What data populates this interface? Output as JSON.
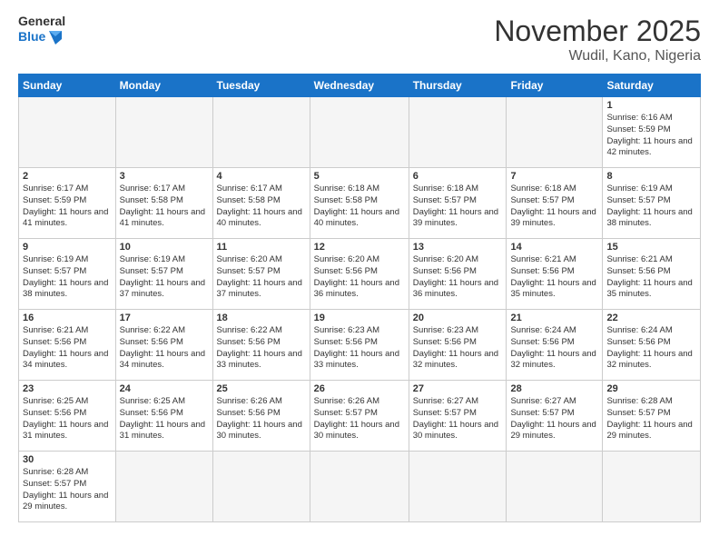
{
  "header": {
    "logo_general": "General",
    "logo_blue": "Blue",
    "month_title": "November 2025",
    "location": "Wudil, Kano, Nigeria"
  },
  "weekdays": [
    "Sunday",
    "Monday",
    "Tuesday",
    "Wednesday",
    "Thursday",
    "Friday",
    "Saturday"
  ],
  "weeks": [
    [
      {
        "day": "",
        "empty": true
      },
      {
        "day": "",
        "empty": true
      },
      {
        "day": "",
        "empty": true
      },
      {
        "day": "",
        "empty": true
      },
      {
        "day": "",
        "empty": true
      },
      {
        "day": "",
        "empty": true
      },
      {
        "day": "1",
        "sunrise": "6:16 AM",
        "sunset": "5:59 PM",
        "daylight": "11 hours and 42 minutes."
      }
    ],
    [
      {
        "day": "2",
        "sunrise": "6:17 AM",
        "sunset": "5:59 PM",
        "daylight": "11 hours and 41 minutes."
      },
      {
        "day": "3",
        "sunrise": "6:17 AM",
        "sunset": "5:58 PM",
        "daylight": "11 hours and 41 minutes."
      },
      {
        "day": "4",
        "sunrise": "6:17 AM",
        "sunset": "5:58 PM",
        "daylight": "11 hours and 40 minutes."
      },
      {
        "day": "5",
        "sunrise": "6:18 AM",
        "sunset": "5:58 PM",
        "daylight": "11 hours and 40 minutes."
      },
      {
        "day": "6",
        "sunrise": "6:18 AM",
        "sunset": "5:57 PM",
        "daylight": "11 hours and 39 minutes."
      },
      {
        "day": "7",
        "sunrise": "6:18 AM",
        "sunset": "5:57 PM",
        "daylight": "11 hours and 39 minutes."
      },
      {
        "day": "8",
        "sunrise": "6:19 AM",
        "sunset": "5:57 PM",
        "daylight": "11 hours and 38 minutes."
      }
    ],
    [
      {
        "day": "9",
        "sunrise": "6:19 AM",
        "sunset": "5:57 PM",
        "daylight": "11 hours and 38 minutes."
      },
      {
        "day": "10",
        "sunrise": "6:19 AM",
        "sunset": "5:57 PM",
        "daylight": "11 hours and 37 minutes."
      },
      {
        "day": "11",
        "sunrise": "6:20 AM",
        "sunset": "5:57 PM",
        "daylight": "11 hours and 37 minutes."
      },
      {
        "day": "12",
        "sunrise": "6:20 AM",
        "sunset": "5:56 PM",
        "daylight": "11 hours and 36 minutes."
      },
      {
        "day": "13",
        "sunrise": "6:20 AM",
        "sunset": "5:56 PM",
        "daylight": "11 hours and 36 minutes."
      },
      {
        "day": "14",
        "sunrise": "6:21 AM",
        "sunset": "5:56 PM",
        "daylight": "11 hours and 35 minutes."
      },
      {
        "day": "15",
        "sunrise": "6:21 AM",
        "sunset": "5:56 PM",
        "daylight": "11 hours and 35 minutes."
      }
    ],
    [
      {
        "day": "16",
        "sunrise": "6:21 AM",
        "sunset": "5:56 PM",
        "daylight": "11 hours and 34 minutes."
      },
      {
        "day": "17",
        "sunrise": "6:22 AM",
        "sunset": "5:56 PM",
        "daylight": "11 hours and 34 minutes."
      },
      {
        "day": "18",
        "sunrise": "6:22 AM",
        "sunset": "5:56 PM",
        "daylight": "11 hours and 33 minutes."
      },
      {
        "day": "19",
        "sunrise": "6:23 AM",
        "sunset": "5:56 PM",
        "daylight": "11 hours and 33 minutes."
      },
      {
        "day": "20",
        "sunrise": "6:23 AM",
        "sunset": "5:56 PM",
        "daylight": "11 hours and 32 minutes."
      },
      {
        "day": "21",
        "sunrise": "6:24 AM",
        "sunset": "5:56 PM",
        "daylight": "11 hours and 32 minutes."
      },
      {
        "day": "22",
        "sunrise": "6:24 AM",
        "sunset": "5:56 PM",
        "daylight": "11 hours and 32 minutes."
      }
    ],
    [
      {
        "day": "23",
        "sunrise": "6:25 AM",
        "sunset": "5:56 PM",
        "daylight": "11 hours and 31 minutes."
      },
      {
        "day": "24",
        "sunrise": "6:25 AM",
        "sunset": "5:56 PM",
        "daylight": "11 hours and 31 minutes."
      },
      {
        "day": "25",
        "sunrise": "6:26 AM",
        "sunset": "5:56 PM",
        "daylight": "11 hours and 30 minutes."
      },
      {
        "day": "26",
        "sunrise": "6:26 AM",
        "sunset": "5:57 PM",
        "daylight": "11 hours and 30 minutes."
      },
      {
        "day": "27",
        "sunrise": "6:27 AM",
        "sunset": "5:57 PM",
        "daylight": "11 hours and 30 minutes."
      },
      {
        "day": "28",
        "sunrise": "6:27 AM",
        "sunset": "5:57 PM",
        "daylight": "11 hours and 29 minutes."
      },
      {
        "day": "29",
        "sunrise": "6:28 AM",
        "sunset": "5:57 PM",
        "daylight": "11 hours and 29 minutes."
      }
    ],
    [
      {
        "day": "30",
        "sunrise": "6:28 AM",
        "sunset": "5:57 PM",
        "daylight": "11 hours and 29 minutes."
      },
      {
        "day": "",
        "empty": true
      },
      {
        "day": "",
        "empty": true
      },
      {
        "day": "",
        "empty": true
      },
      {
        "day": "",
        "empty": true
      },
      {
        "day": "",
        "empty": true
      },
      {
        "day": "",
        "empty": true
      }
    ]
  ],
  "labels": {
    "sunrise_prefix": "Sunrise: ",
    "sunset_prefix": "Sunset: ",
    "daylight_prefix": "Daylight: "
  }
}
